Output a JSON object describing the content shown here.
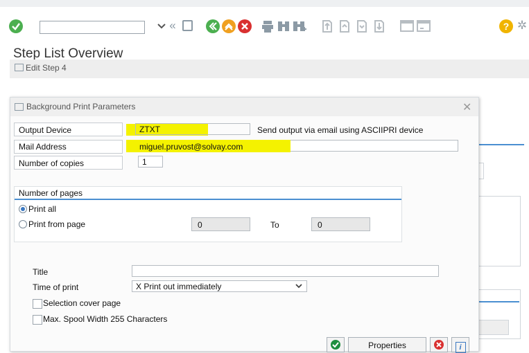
{
  "toolbar": {
    "command_value": "",
    "icons": [
      "enter-icon",
      "dropdown-icon",
      "back-icon",
      "save-icon",
      "nav-back-icon",
      "exit-icon",
      "cancel-icon",
      "print-icon",
      "find-icon",
      "find-next-icon",
      "first-page-icon",
      "prev-page-icon",
      "next-page-icon",
      "last-page-icon",
      "new-session-icon",
      "shortcut-icon",
      "help-icon",
      "settings-icon"
    ],
    "colors": {
      "green": "#4caf50",
      "orange": "#f0a020",
      "red": "#d93030",
      "gray": "#8c9aa5"
    }
  },
  "screen": {
    "title": "Step List Overview",
    "edit_step": "Edit Step",
    "edit_step_number": "4"
  },
  "dialog": {
    "title": "Background Print Parameters",
    "output_device_label": "Output Device",
    "output_device_value": "ZTXT",
    "output_device_note": "Send output via email using ASCIIPRI device",
    "mail_address_label": "Mail Address",
    "mail_address_value": "miguel.pruvost@solvay.com",
    "copies_label": "Number of copies",
    "copies_value": "1",
    "pages_group_title": "Number of pages",
    "print_all_label": "Print all",
    "print_from_label": "Print from page",
    "from_value": "0",
    "to_label": "To",
    "to_value": "0",
    "title_label": "Title",
    "title_value": "",
    "time_label": "Time of print",
    "time_value": "X Print out immediately",
    "cover_label": "Selection cover page",
    "spool_label": "Max. Spool Width 255 Characters",
    "properties_label": "Properties",
    "highlight_color": "#f4f200"
  }
}
